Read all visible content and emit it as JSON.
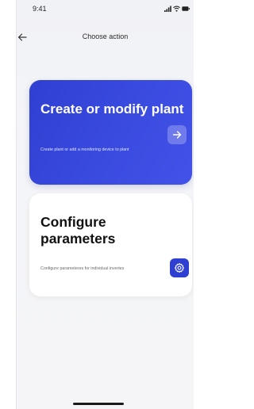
{
  "status_bar": {
    "time": "9:41",
    "icons": [
      "signal-icon",
      "wifi-icon",
      "battery-icon"
    ]
  },
  "header": {
    "back_icon": "arrow-left-icon",
    "title": "Choose action"
  },
  "cards": {
    "create": {
      "title": "Create or modify plant",
      "description": "Create plant or add a monitoring device to plant",
      "icon": "arrow-right-icon",
      "color": "#3443d8"
    },
    "configure": {
      "title": "Configure parameters",
      "description": "Configure parameteres for individual invertes",
      "icon": "gear-icon",
      "color": "#ffffff",
      "icon_bg": "#2f3fd1"
    }
  }
}
